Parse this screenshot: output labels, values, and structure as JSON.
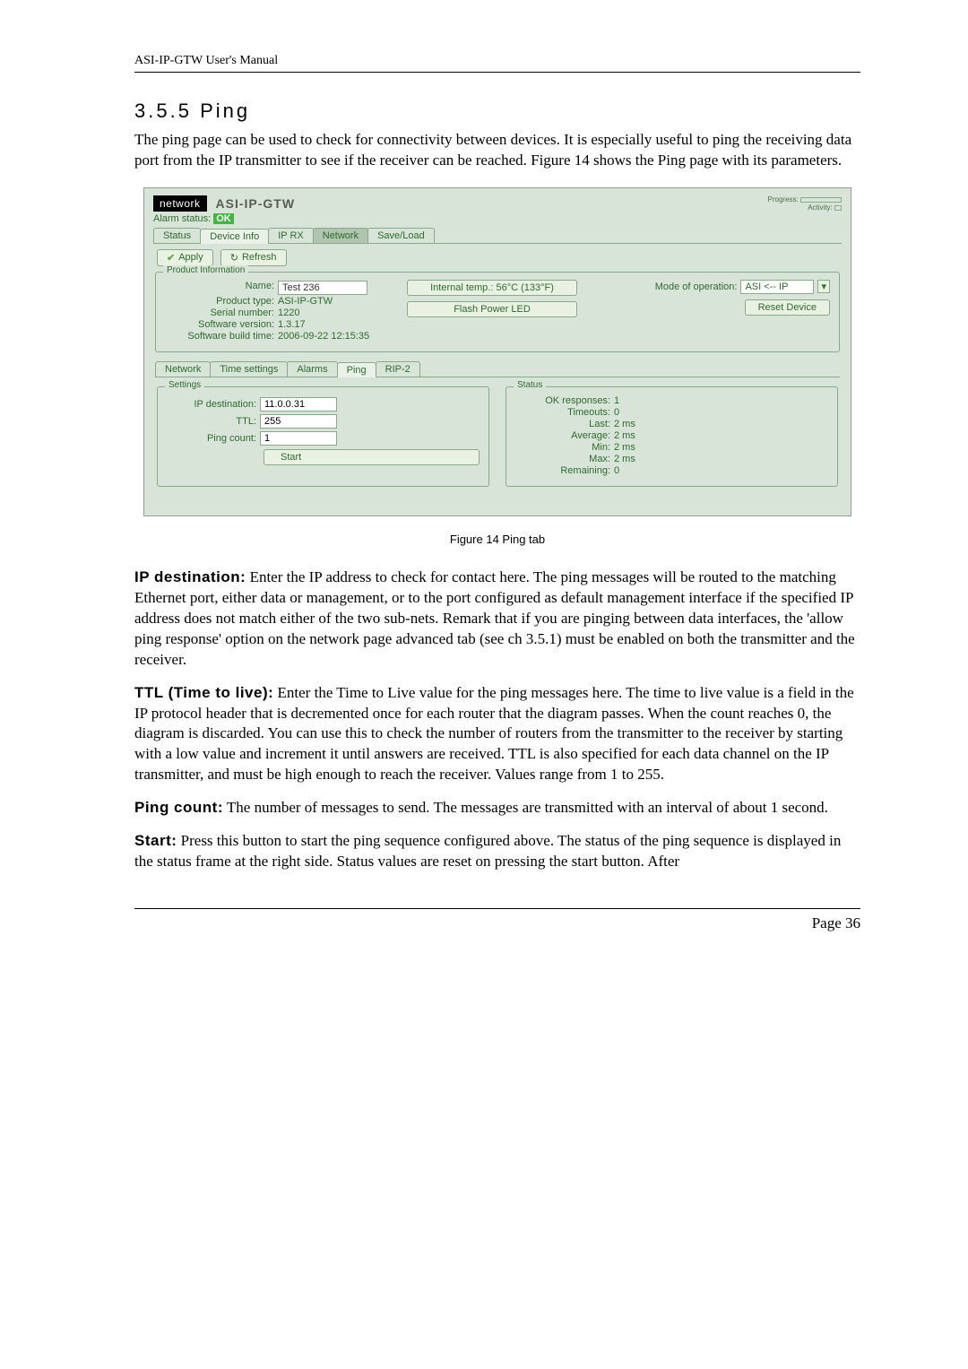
{
  "header": {
    "title": "ASI-IP-GTW User's Manual"
  },
  "section": {
    "number": "3.5.5",
    "title": "Ping"
  },
  "intro": "The ping page can be used to check for connectivity between devices. It is especially useful to ping the receiving data port from the IP transmitter to see if the receiver can be reached. Figure 14 shows the Ping page with its parameters.",
  "figure_caption": "Figure 14 Ping tab",
  "paragraphs": {
    "ip_dest_label": "IP destination:",
    "ip_dest_text": " Enter the IP address to check for contact here. The ping messages will be routed to the matching Ethernet port, either data or management, or to the port configured as default management interface if the specified IP address does not match either of the two sub-nets. Remark that if you are pinging between data interfaces, the 'allow ping response' option on the network page advanced tab (see ch 3.5.1) must be enabled on both the transmitter and the receiver.",
    "ttl_label": "TTL (Time to live):",
    "ttl_text": " Enter the Time to Live value for the ping messages here. The time to live value is a field in the IP protocol header that is decremented once for each router that the diagram passes. When the count reaches 0, the diagram is discarded. You can use this to check the number of routers from the transmitter to the receiver by starting with a low value and increment it until answers are received. TTL is also specified for each data channel on the IP transmitter, and must be high enough to reach the receiver. Values range from 1 to 255.",
    "pc_label": "Ping count:",
    "pc_text": " The number of messages to send. The messages are transmitted with an interval of about 1 second.",
    "start_label": "Start:",
    "start_text": " Press this button to start the ping sequence configured above. The status of the ping sequence is displayed in the status frame at the right side. Status values are reset on pressing the start button. After"
  },
  "footer": {
    "page": "Page 36"
  },
  "shot": {
    "logo": "network",
    "model": "ASI-IP-GTW",
    "progress_label": "Progress:",
    "activity_label": "Activity:",
    "alarm_label": "Alarm status:",
    "alarm_value": "OK",
    "outer_tabs": [
      "Status",
      "Device Info",
      "IP RX",
      "Network",
      "Save/Load"
    ],
    "apply_label": "Apply",
    "refresh_label": "Refresh",
    "product_info_legend": "Product Information",
    "product": {
      "name_label": "Name:",
      "name_value": "Test 236",
      "type_label": "Product type:",
      "type_value": "ASI-IP-GTW",
      "serial_label": "Serial number:",
      "serial_value": "1220",
      "sw_label": "Software version:",
      "sw_value": "1.3.17",
      "build_label": "Software build time:",
      "build_value": "2006-09-22 12:15:35"
    },
    "temp_label": "Internal temp.: 56°C (133°F)",
    "flash_label": "Flash Power LED",
    "mode_label": "Mode of operation:",
    "mode_value": "ASI <-- IP",
    "reset_label": "Reset Device",
    "inner_tabs": [
      "Network",
      "Time settings",
      "Alarms",
      "Ping",
      "RIP-2"
    ],
    "settings_legend": "Settings",
    "settings": {
      "ipdest_label": "IP destination:",
      "ipdest_value": "11.0.0.31",
      "ttl_label": "TTL:",
      "ttl_value": "255",
      "pc_label": "Ping count:",
      "pc_value": "1",
      "start_label": "Start"
    },
    "status_legend": "Status",
    "status": {
      "ok_label": "OK responses:",
      "ok_value": "1",
      "to_label": "Timeouts:",
      "to_value": "0",
      "last_label": "Last:",
      "last_value": "2 ms",
      "avg_label": "Average:",
      "avg_value": "2 ms",
      "min_label": "Min:",
      "min_value": "2 ms",
      "max_label": "Max:",
      "max_value": "2 ms",
      "rem_label": "Remaining:",
      "rem_value": "0"
    }
  }
}
